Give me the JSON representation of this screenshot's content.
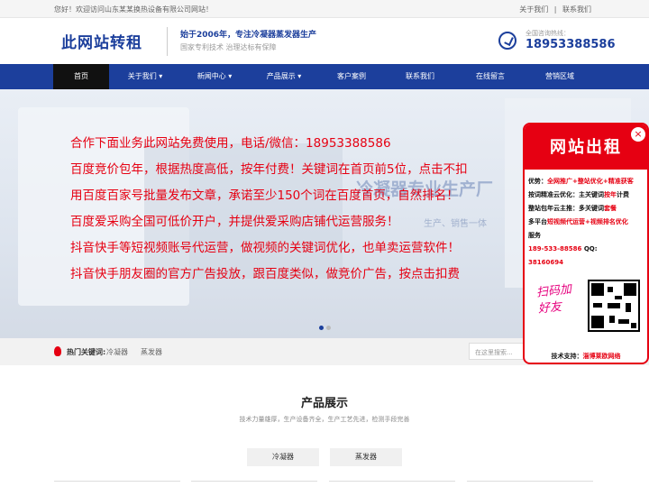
{
  "topbar": {
    "greeting": "您好！欢迎访问山东某某换热设备有限公司网站！",
    "about": "关于我们",
    "separator": "|",
    "contact": "联系我们"
  },
  "header": {
    "logo_text": "此网站转租",
    "slogan_main": "始于2006年，专注冷凝器蒸发器生产",
    "slogan_sub": "国家专利技术 治理达标有保障",
    "hotline_label": "全国咨询热线：",
    "hotline_number": "18953388586"
  },
  "nav": {
    "items": [
      {
        "label": "首页"
      },
      {
        "label": "关于我们 ▾"
      },
      {
        "label": "新闻中心 ▾"
      },
      {
        "label": "产品展示 ▾"
      },
      {
        "label": "客户案例"
      },
      {
        "label": "联系我们"
      },
      {
        "label": "在线留言"
      },
      {
        "label": "营销区域"
      }
    ]
  },
  "banner": {
    "ghost_title": "冷凝器专业生产厂",
    "ghost_sub": "生产、销售一体",
    "ad_lines": [
      "合作下面业务此网站免费使用，电话/微信：18953388586",
      "百度竞价包年，根据热度高低，按年付费！关键词在首页前5位，点击不扣",
      "用百度百家号批量发布文章，承诺至少150个词在百度首页，自然排名！",
      "百度爱采购全国可低价开户，并提供爱采购店铺代运营服务！",
      "抖音快手等短视频账号代运营，做视频的关键词优化，也单卖运营软件！",
      "抖音快手朋友圈的官方广告投放，跟百度类似，做竞价广告，按点击扣费"
    ]
  },
  "hotbar": {
    "label": "热门关键词:",
    "keywords": [
      "冷凝器",
      "蒸发器"
    ],
    "search_placeholder": "在这里搜索..."
  },
  "products": {
    "title": "产品展示",
    "subtitle": "技术力量雄厚，生产设备齐全，生产工艺先进，检测手段完善",
    "tabs": [
      "冷凝器",
      "蒸发器"
    ]
  },
  "popup": {
    "title": "网站出租",
    "close": "×",
    "lines": [
      {
        "a": "优势：",
        "b": "全网推广+整站优化+精准获客"
      },
      {
        "a": "按词精准云优化：",
        "b": "主关键词",
        "c": "按年",
        "d": "计费"
      },
      {
        "a": "整站包年云主推：",
        "b": "多关键词",
        "c": "套餐"
      },
      {
        "a": "多平台",
        "b": "短视频代运营+视频排名优化"
      },
      {
        "a": "服务"
      },
      {
        "a": "189-533-88586",
        "b": " QQ:"
      },
      {
        "a": "38160694"
      }
    ],
    "qr_caption": "扫码加好友",
    "tech_label": "技术支持：",
    "tech_value": "淄博莱欧网络"
  },
  "colors": {
    "brand_blue": "#1c3f9c",
    "ad_red": "#e60012",
    "nav_active": "#111111"
  }
}
